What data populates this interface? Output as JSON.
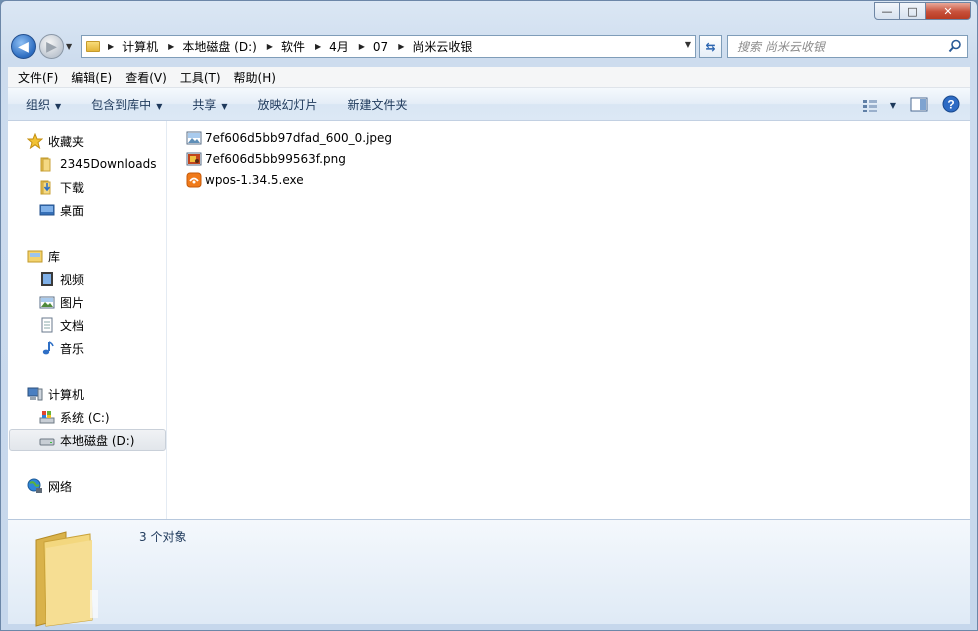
{
  "window": {
    "buttons": {
      "minimize": "—",
      "maximize": "□",
      "close": "✕"
    }
  },
  "nav": {
    "back_icon": "back-arrow-icon",
    "forward_icon": "forward-arrow-icon",
    "breadcrumbs": [
      "计算机",
      "本地磁盘 (D:)",
      "软件",
      "4月",
      "07",
      "尚米云收银"
    ],
    "search_placeholder": "搜索 尚米云收银"
  },
  "menubar": {
    "items": [
      "文件(F)",
      "编辑(E)",
      "查看(V)",
      "工具(T)",
      "帮助(H)"
    ]
  },
  "toolbar": {
    "items": [
      {
        "label": "组织",
        "has_dropdown": true
      },
      {
        "label": "包含到库中",
        "has_dropdown": true
      },
      {
        "label": "共享",
        "has_dropdown": true
      },
      {
        "label": "放映幻灯片",
        "has_dropdown": false
      },
      {
        "label": "新建文件夹",
        "has_dropdown": false
      }
    ],
    "caret": "▼"
  },
  "sidebar": {
    "items": [
      {
        "label": "收藏夹",
        "icon": "star-icon",
        "level": 0
      },
      {
        "label": "2345Downloads",
        "icon": "folder-icon",
        "level": 1
      },
      {
        "label": "下载",
        "icon": "download-folder-icon",
        "level": 1
      },
      {
        "label": "桌面",
        "icon": "desktop-icon",
        "level": 1
      },
      {
        "label": "库",
        "icon": "library-icon",
        "level": 0
      },
      {
        "label": "视频",
        "icon": "video-icon",
        "level": 1
      },
      {
        "label": "图片",
        "icon": "picture-icon",
        "level": 1
      },
      {
        "label": "文档",
        "icon": "document-icon",
        "level": 1
      },
      {
        "label": "音乐",
        "icon": "music-icon",
        "level": 1
      },
      {
        "label": "计算机",
        "icon": "computer-icon",
        "level": 0
      },
      {
        "label": "系统 (C:)",
        "icon": "system-drive-icon",
        "level": 1
      },
      {
        "label": "本地磁盘 (D:)",
        "icon": "drive-icon",
        "level": 1,
        "selected": true
      },
      {
        "label": "网络",
        "icon": "network-icon",
        "level": 0
      }
    ]
  },
  "files": [
    {
      "name": "7ef606d5bb97dfad_600_0.jpeg",
      "icon": "jpeg-image-icon"
    },
    {
      "name": "7ef606d5bb99563f.png",
      "icon": "png-image-icon"
    },
    {
      "name": "wpos-1.34.5.exe",
      "icon": "exe-app-icon"
    }
  ],
  "status": {
    "item_count": "3 个对象"
  },
  "colors": {
    "accent": "#1e395b",
    "selection": "#e2e6eb",
    "folder": "#e8c154"
  }
}
